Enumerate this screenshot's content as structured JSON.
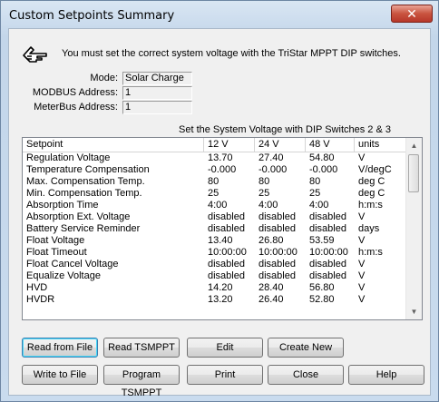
{
  "window": {
    "title": "Custom Setpoints Summary",
    "close_label": "✕"
  },
  "notice": {
    "icon": "pointing-hand-icon",
    "text": "You must set the correct system voltage with the TriStar MPPT DIP switches."
  },
  "fields": {
    "mode": {
      "label": "Mode:",
      "value": "Solar Charge"
    },
    "modbus": {
      "label": "MODBUS Address:",
      "value": "1"
    },
    "meterbus": {
      "label": "MeterBus Address:",
      "value": "1"
    }
  },
  "dip_instruction": "Set the System Voltage with DIP Switches 2 & 3",
  "table": {
    "columns": [
      "Setpoint",
      "12 V",
      "24 V",
      "48 V",
      "units"
    ],
    "rows": [
      [
        "Regulation Voltage",
        "13.70",
        "27.40",
        "54.80",
        "V"
      ],
      [
        "Temperature Compensation",
        "-0.000",
        "-0.000",
        "-0.000",
        "V/degC"
      ],
      [
        "Max. Compensation Temp.",
        "80",
        "80",
        "80",
        "deg C"
      ],
      [
        "Min. Compensation Temp.",
        "25",
        "25",
        "25",
        "deg C"
      ],
      [
        "Absorption Time",
        "4:00",
        "4:00",
        "4:00",
        "h:m:s"
      ],
      [
        "Absorption Ext. Voltage",
        "disabled",
        "disabled",
        "disabled",
        "V"
      ],
      [
        "Battery Service Reminder",
        "disabled",
        "disabled",
        "disabled",
        "days"
      ],
      [
        "Float Voltage",
        "13.40",
        "26.80",
        "53.59",
        "V"
      ],
      [
        "Float Timeout",
        "10:00:00",
        "10:00:00",
        "10:00:00",
        "h:m:s"
      ],
      [
        "Float Cancel Voltage",
        "disabled",
        "disabled",
        "disabled",
        "V"
      ],
      [
        "Equalize Voltage",
        "disabled",
        "disabled",
        "disabled",
        "V"
      ],
      [
        "HVD",
        "14.20",
        "28.40",
        "56.80",
        "V"
      ],
      [
        "HVDR",
        "13.20",
        "26.40",
        "52.80",
        "V"
      ]
    ]
  },
  "buttons": {
    "read_file": "Read from File",
    "read_tsmppt": "Read TSMPPT",
    "edit": "Edit",
    "create_new": "Create New",
    "write_file": "Write to File",
    "program_tsmppt": "Program TSMPPT",
    "print": "Print",
    "close": "Close",
    "help": "Help"
  },
  "scrollbar": {
    "up_icon": "▲",
    "down_icon": "▼"
  }
}
